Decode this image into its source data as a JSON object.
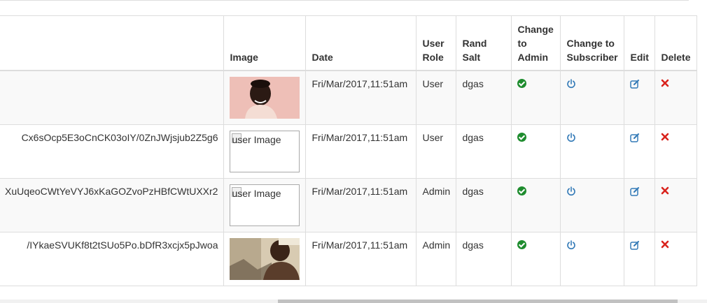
{
  "table": {
    "headers": {
      "hash": "",
      "image": "Image",
      "date": "Date",
      "role": "User Role",
      "salt": "Rand Salt",
      "to_admin": "Change to Admin",
      "to_subscriber": "Change to Subscriber",
      "edit": "Edit",
      "delete": "Delete"
    },
    "rows": [
      {
        "hash": "",
        "image_alt": "user Image",
        "date": "Fri/Mar/2017,11:51am",
        "role": "User",
        "salt": "dgas"
      },
      {
        "hash": "Cx6sOcp5E3oCnCK03oIY/0ZnJWjsjub2Z5g6",
        "image_alt": "user Image",
        "date": "Fri/Mar/2017,11:51am",
        "role": "User",
        "salt": "dgas"
      },
      {
        "hash": "XuUqeoCWtYeVYJ6xKaGOZvoPzHBfCWtUXXr2",
        "image_alt": "user Image",
        "date": "Fri/Mar/2017,11:51am",
        "role": "Admin",
        "salt": "dgas"
      },
      {
        "hash": "/IYkaeSVUKf8t2tSUo5Po.bDfR3xcjx5pJwoa",
        "image_alt": "user Image",
        "date": "Fri/Mar/2017,11:51am",
        "role": "Admin",
        "salt": "dgas"
      }
    ]
  },
  "icons": {
    "admin": "check-circle-icon",
    "subscriber": "power-icon",
    "edit": "edit-icon",
    "delete": "close-icon"
  },
  "colors": {
    "admin_icon": "#1e8c2e",
    "subscriber_icon": "#337ab7",
    "edit_icon": "#337ab7",
    "delete_icon": "#d9231d",
    "striped_row": "#f9f9f9",
    "border": "#dddddd"
  }
}
